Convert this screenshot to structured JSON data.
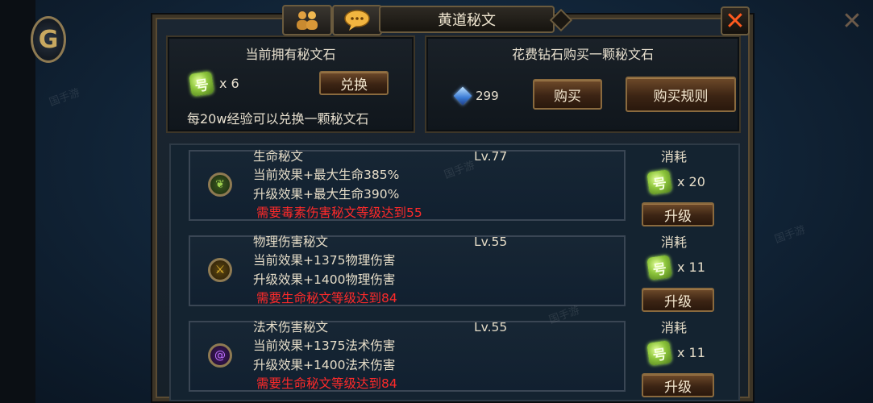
{
  "window": {
    "title": "黄道秘文",
    "close_glyph": "✕"
  },
  "owned_panel": {
    "heading": "当前拥有秘文石",
    "stone_count": "x 6",
    "exchange_button": "兑换",
    "note": "每20w经验可以兑换一颗秘文石"
  },
  "buy_panel": {
    "heading": "花费钻石购买一颗秘文石",
    "diamond_price": "299",
    "buy_button": "购买",
    "rules_button": "购买规则"
  },
  "runes": [
    {
      "name": "生命秘文",
      "level": "Lv.77",
      "current": "当前效果+最大生命385%",
      "next": "升级效果+最大生命390%",
      "requirement": "需要毒素伤害秘文等级达到55",
      "cost_label": "消耗",
      "cost_qty": "x 20",
      "upgrade_button": "升级",
      "icon": "leaf-rune-icon",
      "icon_color": "#7fb03a"
    },
    {
      "name": "物理伤害秘文",
      "level": "Lv.55",
      "current": "当前效果+1375物理伤害",
      "next": "升级效果+1400物理伤害",
      "requirement": "需要生命秘文等级达到84",
      "cost_label": "消耗",
      "cost_qty": "x 11",
      "upgrade_button": "升级",
      "icon": "sword-rune-icon",
      "icon_color": "#d8a020"
    },
    {
      "name": "法术伤害秘文",
      "level": "Lv.55",
      "current": "当前效果+1375法术伤害",
      "next": "升级效果+1400法术伤害",
      "requirement": "需要生命秘文等级达到84",
      "cost_label": "消耗",
      "cost_qty": "x 11",
      "upgrade_button": "升级",
      "icon": "magic-swirl-rune-icon",
      "icon_color": "#9a3adf"
    }
  ],
  "icons": {
    "stone": "秘文石-gem-icon",
    "diamond": "diamond-icon",
    "tab_friends": "people-icon",
    "tab_chat": "chat-bubble-icon",
    "close": "close-icon"
  },
  "watermark_text": "国手游",
  "colors": {
    "requirement": "#ff2a2a",
    "close": "#ff5a1f",
    "button_brown": "#6e4a2a"
  }
}
